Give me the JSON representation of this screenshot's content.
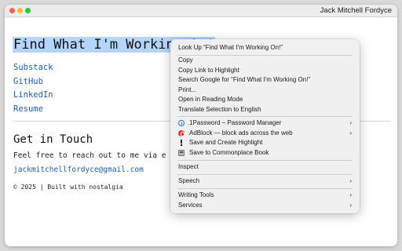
{
  "window": {
    "title": "Jack Mitchell Fordyce"
  },
  "page": {
    "title": "Find What I'm Working On!",
    "nav_links": [
      "Substack",
      "GitHub",
      "LinkedIn",
      "Resume"
    ],
    "contact": {
      "heading": "Get in Touch",
      "text": "Feel free to reach out to me via e",
      "email": "jackmitchellfordyce@gmail.com"
    },
    "footer": "© 2025 | Built with nostalgia"
  },
  "context_menu": {
    "look_up": "Look Up “Find What I'm Working On!”",
    "copy": "Copy",
    "copy_link_to_highlight": "Copy Link to Highlight",
    "search_google": "Search Google for “Find What I'm Working On!”",
    "print": "Print...",
    "open_reading_mode": "Open in Reading Mode",
    "translate": "Translate Selection to English",
    "onepassword": "1Password – Password Manager",
    "adblock": "AdBlock — block ads across the web",
    "save_highlight": "Save and Create Highlight",
    "save_commonplace": "Save to Commonplace Book",
    "inspect": "Inspect",
    "speech": "Speech",
    "writing_tools": "Writing Tools",
    "services": "Services"
  },
  "colors": {
    "link": "#1f5fa8",
    "selection": "#b4d5fe",
    "close": "#ff5f57",
    "minimize": "#febc2e",
    "maximize": "#28c840"
  }
}
